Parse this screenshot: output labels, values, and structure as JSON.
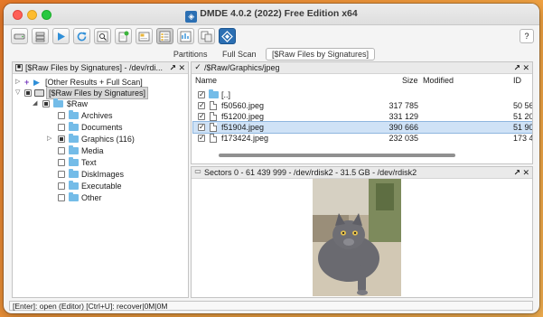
{
  "window": {
    "title": "DMDE 4.0.2 (2022) Free Edition x64",
    "app_icon_glyph": "◈"
  },
  "toolbar": {
    "buttons": [
      {
        "name": "open-disk-button",
        "icon": "drive-icon"
      },
      {
        "name": "partitions-button",
        "icon": "stack-icon"
      },
      {
        "name": "play-button",
        "icon": "play-icon"
      },
      {
        "name": "refresh-button",
        "icon": "refresh-icon"
      },
      {
        "name": "find-button",
        "icon": "magnifier-icon"
      },
      {
        "name": "clipboard-button",
        "icon": "clipboard-icon"
      },
      {
        "name": "sectors-button",
        "icon": "sector-icon"
      },
      {
        "name": "list-view-button",
        "icon": "list-icon"
      },
      {
        "name": "details-button",
        "icon": "details-icon"
      },
      {
        "name": "copy-button",
        "icon": "copy-icon"
      },
      {
        "name": "dmde-logo-button",
        "icon": "dmde-logo-icon"
      }
    ],
    "help_label": "?"
  },
  "tabs": [
    {
      "label": "Partitions",
      "active": false
    },
    {
      "label": "Full Scan",
      "active": false
    },
    {
      "label": "[$Raw Files by Signatures]",
      "active": true
    }
  ],
  "tree_pane": {
    "header": "[$Raw Files by Signatures] - /dev/rdi...",
    "pin_glyph": "↗",
    "close_glyph": "✕",
    "items": [
      {
        "label": "[Other Results + Full Scan]",
        "level": 0,
        "expander": "▷",
        "check": "plus",
        "icon": "play"
      },
      {
        "label": "[$Raw Files by Signatures]",
        "level": 0,
        "expander": "▽",
        "check": "partial",
        "icon": "disk",
        "selected": true
      },
      {
        "label": "$Raw",
        "level": 1,
        "expander": "◢",
        "check": "partial",
        "icon": "folder"
      },
      {
        "label": "Archives",
        "level": 2,
        "expander": "",
        "check": "none",
        "icon": "folder"
      },
      {
        "label": "Documents",
        "level": 2,
        "expander": "",
        "check": "none",
        "icon": "folder"
      },
      {
        "label": "Graphics (116)",
        "level": 2,
        "expander": "▷",
        "check": "partial",
        "icon": "folder"
      },
      {
        "label": "Media",
        "level": 2,
        "expander": "",
        "check": "none",
        "icon": "folder"
      },
      {
        "label": "Text",
        "level": 2,
        "expander": "",
        "check": "none",
        "icon": "folder"
      },
      {
        "label": "DiskImages",
        "level": 2,
        "expander": "",
        "check": "none",
        "icon": "folder"
      },
      {
        "label": "Executable",
        "level": 2,
        "expander": "",
        "check": "none",
        "icon": "folder"
      },
      {
        "label": "Other",
        "level": 2,
        "expander": "",
        "check": "none",
        "icon": "folder"
      }
    ]
  },
  "file_pane": {
    "header": "/$Raw/Graphics/jpeg",
    "columns": {
      "name": "Name",
      "size": "Size",
      "modified": "Modified",
      "id": "ID"
    },
    "rows": [
      {
        "name": "[..]",
        "size": "",
        "id": "",
        "type": "folder",
        "checked": true,
        "selected": false
      },
      {
        "name": "f50560.jpeg",
        "size": "317 785",
        "id": "50 56",
        "type": "file",
        "checked": true,
        "selected": false
      },
      {
        "name": "f51200.jpeg",
        "size": "331 129",
        "id": "51 20",
        "type": "file",
        "checked": true,
        "selected": false
      },
      {
        "name": "f51904.jpeg",
        "size": "390 666",
        "id": "51 90",
        "type": "file",
        "checked": true,
        "selected": true
      },
      {
        "name": "f173424.jpeg",
        "size": "232 035",
        "id": "173 4",
        "type": "file",
        "checked": true,
        "selected": false
      }
    ]
  },
  "preview_pane": {
    "header": "Sectors 0 - 61 439 999 - /dev/rdisk2 - 31.5 GB - /dev/rdisk2"
  },
  "status": {
    "text": "[Enter]: open (Editor)  [Ctrl+U]: recover|0M|0M"
  }
}
